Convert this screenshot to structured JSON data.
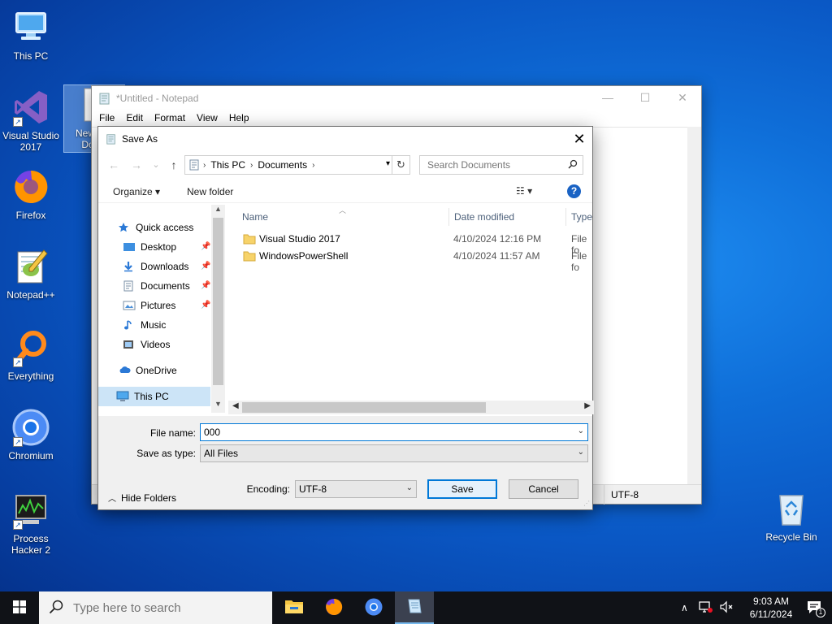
{
  "desktop": {
    "icons": [
      {
        "label": "This PC"
      },
      {
        "label": "Visual Studio 2017"
      },
      {
        "label": "New R... Doc..."
      },
      {
        "label": "Firefox"
      },
      {
        "label": "Notepad++"
      },
      {
        "label": "Everything"
      },
      {
        "label": "Chromium"
      },
      {
        "label": "Process Hacker 2"
      },
      {
        "label": "Recycle Bin"
      }
    ],
    "icon_names": [
      "computer-icon",
      "visual-studio-icon",
      "document-icon",
      "firefox-icon",
      "notepad-plus-plus-icon",
      "everything-search-icon",
      "chromium-icon",
      "process-hacker-icon",
      "recycle-bin-icon"
    ]
  },
  "notepad": {
    "title": "*Untitled - Notepad",
    "menu": [
      "File",
      "Edit",
      "Format",
      "View",
      "Help"
    ],
    "status_encoding": "UTF-8",
    "controls": {
      "minimize": "—",
      "maximize": "☐",
      "close": "✕"
    }
  },
  "dialog": {
    "title": "Save As",
    "close": "✕",
    "nav": {
      "back": "←",
      "forward": "→",
      "recent": "⌄",
      "up": "↑"
    },
    "address": {
      "segments": [
        "This PC",
        "Documents"
      ],
      "separator": "›"
    },
    "search_placeholder": "Search Documents",
    "commands": {
      "organize": "Organize ▾",
      "new_folder": "New folder",
      "view": "☷ ▾",
      "help": "?"
    },
    "nav_pane": {
      "quick_access": "Quick access",
      "items": [
        "Desktop",
        "Downloads",
        "Documents",
        "Pictures",
        "Music",
        "Videos"
      ],
      "onedrive": "OneDrive",
      "this_pc": "This PC"
    },
    "columns": {
      "name": "Name",
      "date": "Date modified",
      "type": "Type"
    },
    "files": [
      {
        "name": "Visual Studio 2017",
        "date": "4/10/2024 12:16 PM",
        "type": "File fo"
      },
      {
        "name": "WindowsPowerShell",
        "date": "4/10/2024 11:57 AM",
        "type": "File fo"
      }
    ],
    "file_name_label": "File name:",
    "file_name_value": "000",
    "save_type_label": "Save as type:",
    "save_type_value": "All Files",
    "hide_folders": "Hide Folders",
    "encoding_label": "Encoding:",
    "encoding_value": "UTF-8",
    "save_button": "Save",
    "cancel_button": "Cancel"
  },
  "taskbar": {
    "search_placeholder": "Type here to search",
    "time": "9:03 AM",
    "date": "6/11/2024",
    "notification_count": "1"
  },
  "colors": {
    "accent": "#0078d7",
    "selection": "#cce4f7",
    "folder": "#f7d36a",
    "taskbar": "#101217"
  }
}
